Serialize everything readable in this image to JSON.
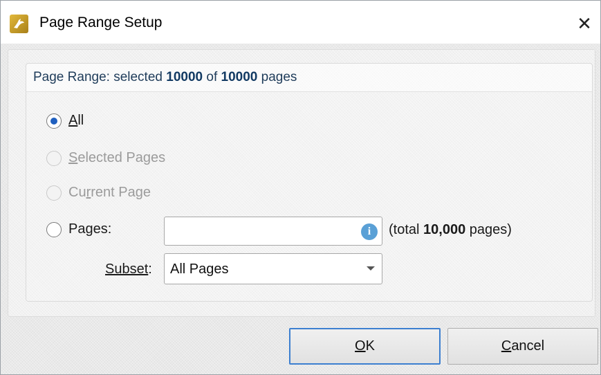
{
  "window": {
    "title": "Page Range Setup",
    "close_glyph": "✕"
  },
  "header": {
    "prefix": "Page Range: selected ",
    "selected_count": "10000",
    "middle": " of ",
    "total_count": "10000",
    "suffix": " pages"
  },
  "options": {
    "all": {
      "mnemonic": "A",
      "rest": "ll",
      "checked": true,
      "enabled": true
    },
    "selected_pages": {
      "mnemonic": "S",
      "rest": "elected Pages",
      "checked": false,
      "enabled": false
    },
    "current_page": {
      "before": "Cu",
      "mnemonic": "r",
      "rest": "rent Page",
      "checked": false,
      "enabled": false
    },
    "pages": {
      "before": "Pa",
      "mnemonic": "g",
      "rest": "es:",
      "checked": false,
      "enabled": true
    }
  },
  "pages_input": {
    "value": "",
    "placeholder": ""
  },
  "info_icon": {
    "name": "info-icon",
    "glyph": "i",
    "color": "#5aa0d6"
  },
  "total": {
    "prefix": "(total ",
    "count": "10,000",
    "suffix": " pages)"
  },
  "subset": {
    "label_before": "Subset",
    "label_after": ":",
    "selected": "All Pages"
  },
  "buttons": {
    "ok": {
      "mnemonic": "O",
      "rest": "K"
    },
    "cancel": {
      "mnemonic": "C",
      "rest": "ancel"
    }
  },
  "colors": {
    "accent": "#3c7fd0",
    "radio_selected": "#1f5fbf",
    "header_text": "#1f3c5a",
    "app_icon": "#c9a227"
  }
}
